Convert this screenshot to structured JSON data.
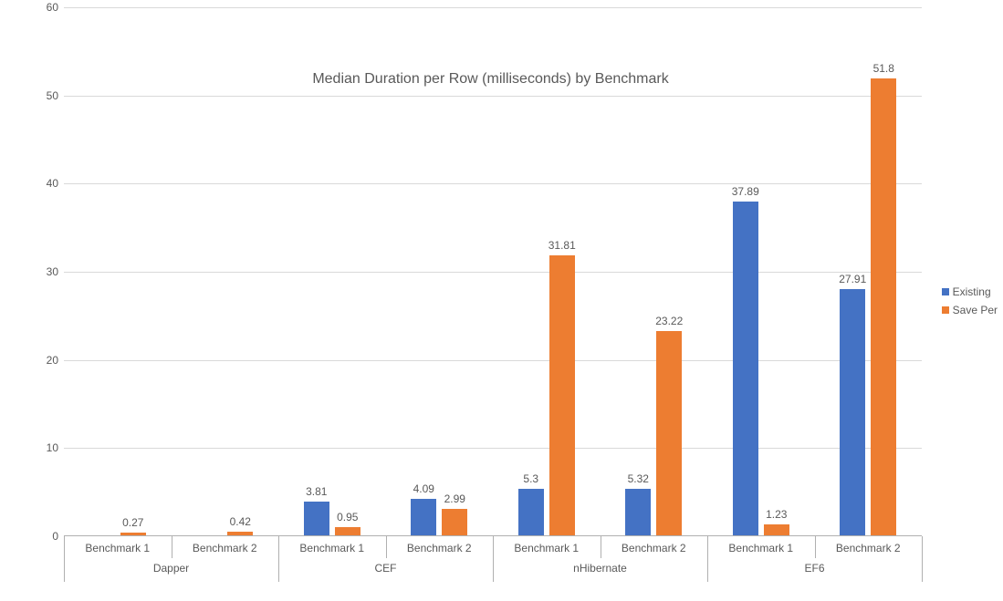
{
  "chart_data": {
    "type": "bar",
    "title": "Median Duration per Row (milliseconds) by Benchmark",
    "ylabel": "",
    "xlabel": "",
    "ylim": [
      0,
      60
    ],
    "ytick_step": 10,
    "groups": [
      {
        "name": "Dapper",
        "sub": [
          "Benchmark 1",
          "Benchmark 2"
        ]
      },
      {
        "name": "CEF",
        "sub": [
          "Benchmark 1",
          "Benchmark 2"
        ]
      },
      {
        "name": "nHibernate",
        "sub": [
          "Benchmark 1",
          "Benchmark 2"
        ]
      },
      {
        "name": "EF6",
        "sub": [
          "Benchmark 1",
          "Benchmark 2"
        ]
      }
    ],
    "series": [
      {
        "name": "Existing",
        "color": "#4472C4",
        "values": [
          null,
          null,
          3.81,
          4.09,
          5.3,
          5.32,
          37.89,
          27.91
        ]
      },
      {
        "name": "Save Per",
        "color": "#ED7D31",
        "values": [
          0.27,
          0.42,
          0.95,
          2.99,
          31.81,
          23.22,
          1.23,
          51.8
        ]
      }
    ],
    "legend": {
      "position": "right",
      "items": [
        "Existing",
        "Save Per"
      ]
    }
  },
  "yticks": [
    "0",
    "10",
    "20",
    "30",
    "40",
    "50",
    "60"
  ]
}
